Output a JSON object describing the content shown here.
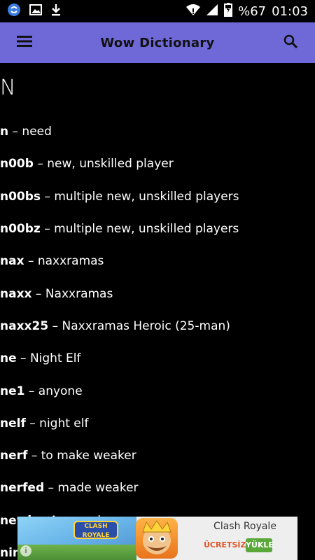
{
  "status_bar": {
    "battery_percent": "%67",
    "time": "01:03"
  },
  "app_bar": {
    "title": "Wow Dictionary"
  },
  "section": {
    "letter": "N"
  },
  "entries": [
    {
      "term": "n",
      "definition": " – need"
    },
    {
      "term": "n00b",
      "definition": " – new, unskilled player"
    },
    {
      "term": "n00bs",
      "definition": " – multiple new, unskilled players"
    },
    {
      "term": "n00bz",
      "definition": " – multiple new, unskilled players"
    },
    {
      "term": "nax",
      "definition": " – naxxramas"
    },
    {
      "term": "naxx",
      "definition": " – Naxxramas"
    },
    {
      "term": "naxx25",
      "definition": " – Naxxramas Heroic (25-man)"
    },
    {
      "term": "ne",
      "definition": " – Night Elf"
    },
    {
      "term": "ne1",
      "definition": " – anyone"
    },
    {
      "term": "nelf",
      "definition": " – night elf"
    },
    {
      "term": "nerf",
      "definition": " – to make weaker"
    },
    {
      "term": "nerfed",
      "definition": " – made weaker"
    },
    {
      "term": "newb",
      "definition": " – A new player"
    },
    {
      "term": "nin",
      "definition": ""
    }
  ],
  "ad": {
    "app_name": "Clash Royale",
    "logo_text": "CLASH ROYALE",
    "free_label": "ÜCRETSİZ",
    "install_label": "YÜKLE",
    "info_symbol": "i"
  },
  "colors": {
    "app_bar": "#6f69d8",
    "background": "#000000",
    "install_button": "#5aa83a"
  }
}
